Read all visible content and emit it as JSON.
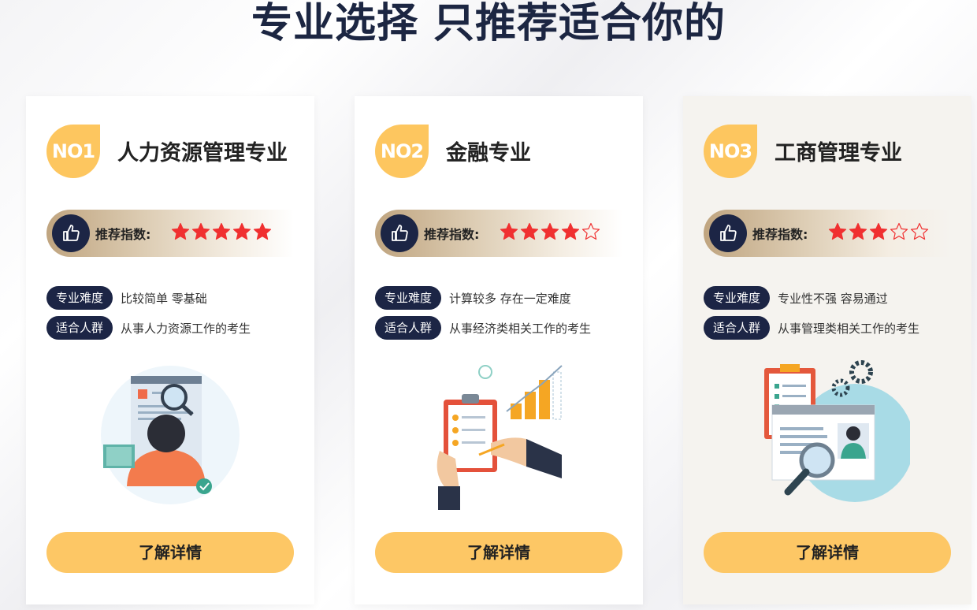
{
  "page": {
    "title": "专业选择 只推荐适合你的"
  },
  "cards": [
    {
      "badge": "NO1",
      "name": "人力资源管理专业",
      "rating_label": "推荐指数:",
      "rating": 5,
      "difficulty_tag": "专业难度",
      "difficulty_text": "比较简单 零基础",
      "audience_tag": "适合人群",
      "audience_text": "从事人力资源工作的考生",
      "illustration_icon": "hr-magnifier-illustration",
      "cta_label": "了解详情"
    },
    {
      "badge": "NO2",
      "name": "金融专业",
      "rating_label": "推荐指数:",
      "rating": 4,
      "difficulty_tag": "专业难度",
      "difficulty_text": "计算较多 存在一定难度",
      "audience_tag": "适合人群",
      "audience_text": "从事经济类相关工作的考生",
      "illustration_icon": "finance-clipboard-illustration",
      "cta_label": "了解详情"
    },
    {
      "badge": "NO3",
      "name": "工商管理专业",
      "rating_label": "推荐指数:",
      "rating": 3,
      "difficulty_tag": "专业难度",
      "difficulty_text": "专业性不强 容易通过",
      "audience_tag": "适合人群",
      "audience_text": "从事管理类相关工作的考生",
      "illustration_icon": "business-cv-illustration",
      "cta_label": "了解详情"
    }
  ],
  "colors": {
    "navy": "#1c2545",
    "gold": "#fdc65f",
    "star": "#f03030",
    "title": "#1c2642"
  }
}
